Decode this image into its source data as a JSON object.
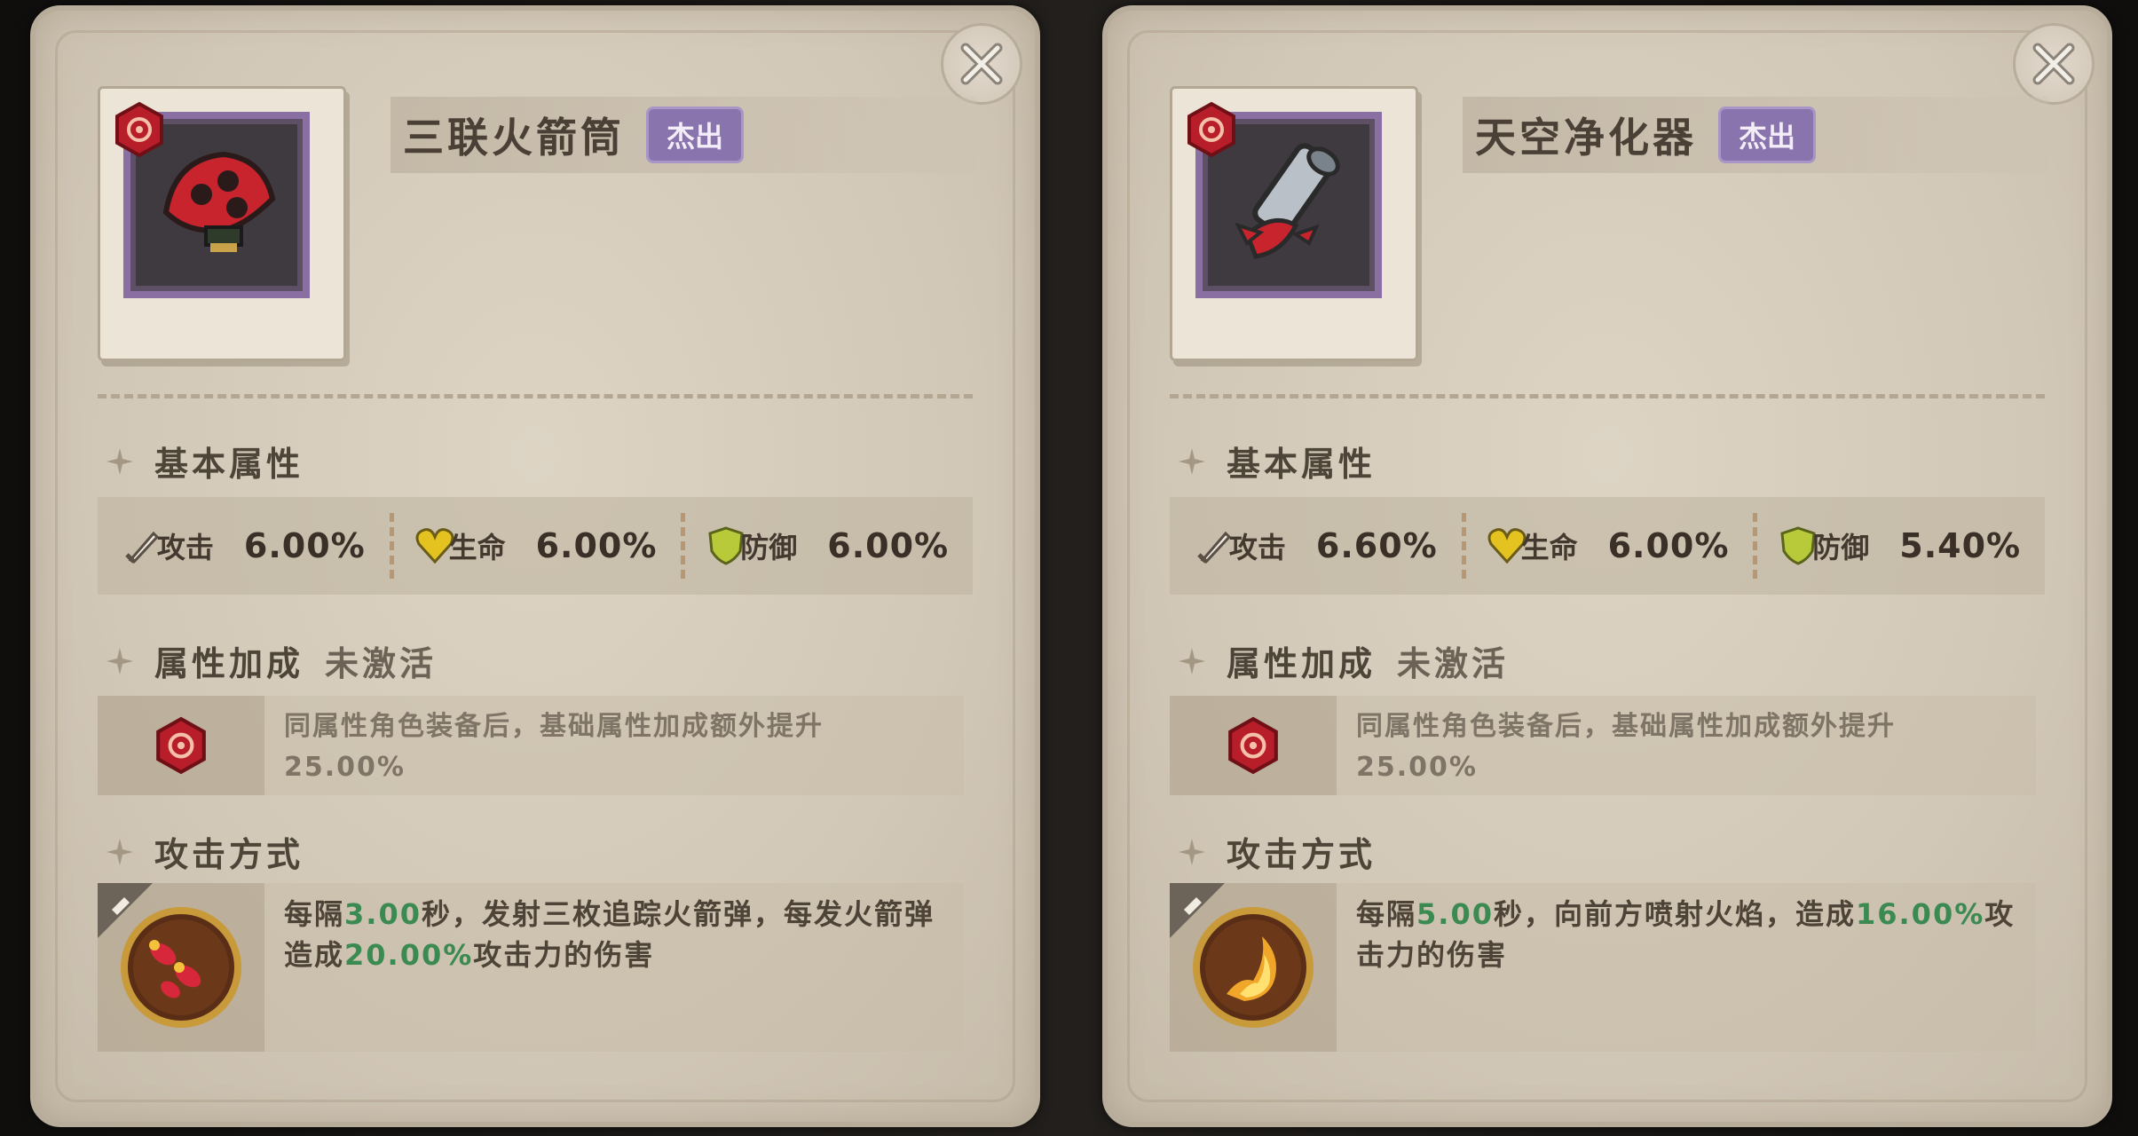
{
  "panels": [
    {
      "item_name": "三联火箭筒",
      "rarity": "杰出",
      "basic_title": "基本属性",
      "stats": [
        {
          "icon": "sword-icon",
          "label": "攻击",
          "value": "6.00%"
        },
        {
          "icon": "heart-icon",
          "label": "生命",
          "value": "6.00%"
        },
        {
          "icon": "shield-icon",
          "label": "防御",
          "value": "6.00%"
        }
      ],
      "bonus_title": "属性加成",
      "bonus_status": "未激活",
      "bonus_line1": "同属性角色装备后，基础属性加成额外提升",
      "bonus_line2": "25.00%",
      "attack_title": "攻击方式",
      "attack": {
        "p1": "每隔",
        "interval": "3.00",
        "p2": "秒，发射三枚追踪火箭弹，每发火箭弹造成",
        "damage": "20.00%",
        "p3": "攻击力的伤害"
      },
      "item_icon": "triple-rocket-launcher-icon",
      "attack_icon": "rockets-icon"
    },
    {
      "item_name": "天空净化器",
      "rarity": "杰出",
      "basic_title": "基本属性",
      "stats": [
        {
          "icon": "sword-icon",
          "label": "攻击",
          "value": "6.60%"
        },
        {
          "icon": "heart-icon",
          "label": "生命",
          "value": "6.00%"
        },
        {
          "icon": "shield-icon",
          "label": "防御",
          "value": "5.40%"
        }
      ],
      "bonus_title": "属性加成",
      "bonus_status": "未激活",
      "bonus_line1": "同属性角色装备后，基础属性加成额外提升",
      "bonus_line2": "25.00%",
      "attack_title": "攻击方式",
      "attack": {
        "p1": "每隔",
        "interval": "5.00",
        "p2": "秒，向前方喷射火焰，造成",
        "damage": "16.00%",
        "p3": "攻击力的伤害"
      },
      "item_icon": "flamethrower-icon",
      "attack_icon": "flame-icon"
    }
  ],
  "colors": {
    "panel_bg": "#d2c8b8",
    "rarity_purple": "#8a74ae",
    "highlight_green": "#3a8a52",
    "element_red": "#c8242e"
  }
}
